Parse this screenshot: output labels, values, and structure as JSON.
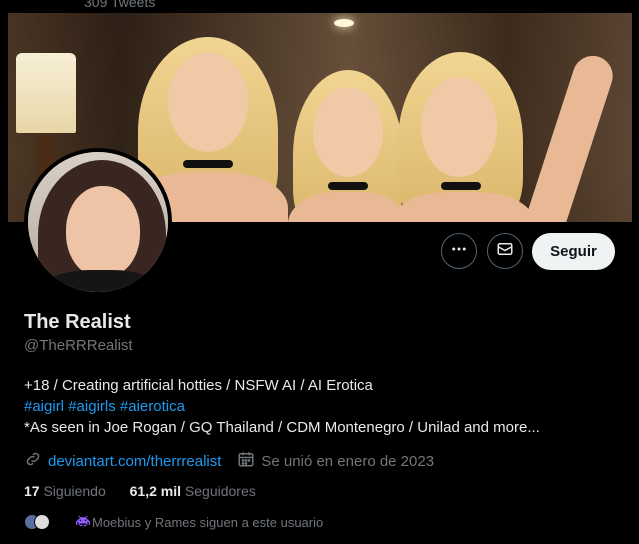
{
  "header": {
    "tweet_count": "309 Tweets"
  },
  "actions": {
    "more_icon": "more-horizontal-icon",
    "message_icon": "envelope-icon",
    "follow_label": "Seguir"
  },
  "profile": {
    "name": "The Realist",
    "handle": "@TheRRRealist",
    "bio_line1": "+18 / Creating artificial hotties / NSFW AI / AI Erotica",
    "hashtags": [
      "#aigirl",
      "#aigirls",
      "#aierotica"
    ],
    "bio_line3": "*As seen in Joe Rogan / GQ Thailand / CDM Montenegro / Unilad and more...",
    "link": "deviantart.com/therrrealist",
    "joined": "Se unió en enero de 2023"
  },
  "stats": {
    "following_count": "17",
    "following_label": "Siguiendo",
    "followers_count": "61,2 mil",
    "followers_label": "Seguidores"
  },
  "mutual": {
    "text": "Moebius y Rames siguen a este usuario"
  },
  "colors": {
    "accent": "#1d9bf0",
    "muted": "#71767b",
    "text": "#e7e9ea"
  }
}
